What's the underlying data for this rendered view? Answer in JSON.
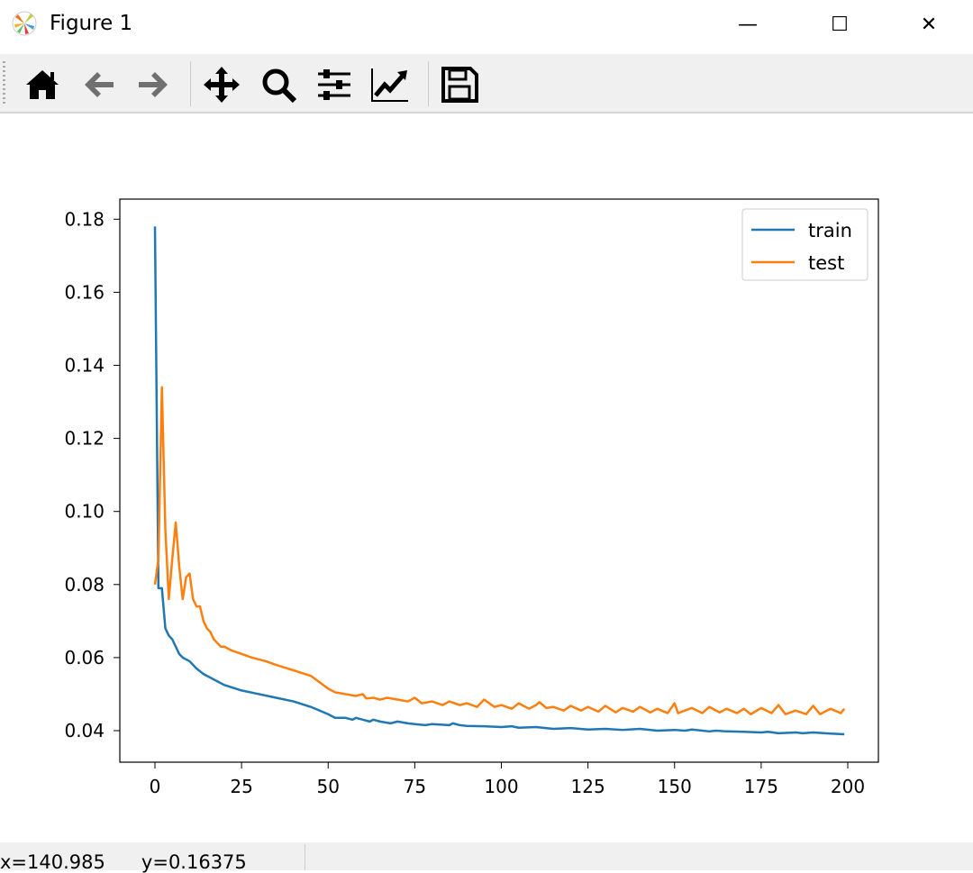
{
  "window": {
    "title": "Figure 1",
    "minimize": "—",
    "maximize": "☐",
    "close": "✕"
  },
  "toolbar": {
    "buttons": [
      "home-icon",
      "back-icon",
      "forward-icon",
      "pan-icon",
      "zoom-icon",
      "configure-subplots-icon",
      "edit-axis-icon",
      "save-icon"
    ]
  },
  "status": {
    "text": "x=140.985      y=0.16375"
  },
  "chart_data": {
    "type": "line",
    "title": "",
    "xlabel": "",
    "ylabel": "",
    "xlim": [
      -10,
      210
    ],
    "ylim": [
      0.032,
      0.1825
    ],
    "xticks": [
      0,
      25,
      50,
      75,
      100,
      125,
      150,
      175,
      200
    ],
    "xtick_labels": [
      "0",
      "25",
      "50",
      "75",
      "100",
      "125",
      "150",
      "175",
      "200"
    ],
    "yticks": [
      0.04,
      0.06,
      0.08,
      0.1,
      0.12,
      0.14,
      0.16,
      0.18
    ],
    "ytick_labels": [
      "0.04",
      "0.06",
      "0.08",
      "0.10",
      "0.12",
      "0.14",
      "0.16",
      "0.18"
    ],
    "legend": {
      "placement": "top-right",
      "entries": [
        "train",
        "test"
      ]
    },
    "grid": false,
    "series": [
      {
        "name": "train",
        "color": "#1f77b4",
        "x": [
          0,
          1,
          2,
          3,
          4,
          5,
          6,
          7,
          8,
          9,
          10,
          12,
          14,
          16,
          18,
          20,
          25,
          30,
          35,
          40,
          45,
          50,
          52,
          55,
          57,
          58,
          60,
          62,
          63,
          65,
          68,
          70,
          73,
          75,
          78,
          80,
          85,
          86,
          88,
          90,
          95,
          100,
          103,
          105,
          110,
          115,
          120,
          125,
          130,
          135,
          140,
          145,
          150,
          153,
          155,
          160,
          162,
          165,
          170,
          175,
          177,
          180,
          185,
          187,
          190,
          195,
          199
        ],
        "y": [
          0.178,
          0.079,
          0.079,
          0.068,
          0.066,
          0.065,
          0.063,
          0.061,
          0.06,
          0.0595,
          0.059,
          0.057,
          0.0555,
          0.0545,
          0.0535,
          0.0525,
          0.051,
          0.05,
          0.049,
          0.048,
          0.0465,
          0.0445,
          0.0435,
          0.0435,
          0.043,
          0.0435,
          0.043,
          0.0425,
          0.043,
          0.0425,
          0.042,
          0.0425,
          0.042,
          0.0418,
          0.0415,
          0.0418,
          0.0415,
          0.042,
          0.0415,
          0.0413,
          0.0412,
          0.041,
          0.0412,
          0.0408,
          0.041,
          0.0405,
          0.0407,
          0.0403,
          0.0405,
          0.0402,
          0.0405,
          0.04,
          0.0402,
          0.04,
          0.0403,
          0.0398,
          0.04,
          0.0398,
          0.0397,
          0.0395,
          0.0397,
          0.0393,
          0.0395,
          0.0393,
          0.0395,
          0.0392,
          0.039
        ]
      },
      {
        "name": "test",
        "color": "#ff7f0e",
        "x": [
          0,
          1,
          2,
          3,
          4,
          5,
          6,
          7,
          8,
          9,
          10,
          11,
          12,
          13,
          14,
          15,
          16,
          17,
          18,
          19,
          20,
          22,
          25,
          28,
          30,
          32,
          35,
          40,
          45,
          50,
          52,
          55,
          58,
          60,
          61,
          63,
          65,
          67,
          70,
          73,
          75,
          77,
          80,
          83,
          85,
          88,
          90,
          93,
          95,
          98,
          100,
          103,
          105,
          108,
          110,
          111,
          113,
          115,
          118,
          120,
          123,
          125,
          128,
          130,
          133,
          135,
          138,
          140,
          143,
          145,
          148,
          150,
          151,
          153,
          155,
          158,
          160,
          163,
          165,
          168,
          170,
          172,
          175,
          178,
          180,
          182,
          185,
          188,
          190,
          192,
          195,
          198,
          199
        ],
        "y": [
          0.08,
          0.087,
          0.134,
          0.095,
          0.076,
          0.087,
          0.097,
          0.085,
          0.076,
          0.082,
          0.083,
          0.076,
          0.074,
          0.074,
          0.07,
          0.068,
          0.067,
          0.065,
          0.064,
          0.063,
          0.063,
          0.062,
          0.061,
          0.06,
          0.0595,
          0.059,
          0.058,
          0.0565,
          0.055,
          0.0515,
          0.0505,
          0.05,
          0.0495,
          0.05,
          0.0488,
          0.049,
          0.0485,
          0.049,
          0.0485,
          0.048,
          0.049,
          0.0475,
          0.048,
          0.047,
          0.048,
          0.047,
          0.0475,
          0.0465,
          0.0485,
          0.0465,
          0.047,
          0.046,
          0.0475,
          0.046,
          0.047,
          0.0478,
          0.0462,
          0.0465,
          0.0455,
          0.0468,
          0.0455,
          0.0465,
          0.0452,
          0.0468,
          0.045,
          0.0462,
          0.0452,
          0.0465,
          0.045,
          0.046,
          0.0448,
          0.0475,
          0.0448,
          0.0455,
          0.0462,
          0.0448,
          0.0465,
          0.045,
          0.046,
          0.0448,
          0.046,
          0.0445,
          0.0462,
          0.0448,
          0.047,
          0.0445,
          0.0455,
          0.0445,
          0.0468,
          0.0445,
          0.046,
          0.0448,
          0.046
        ]
      }
    ]
  }
}
